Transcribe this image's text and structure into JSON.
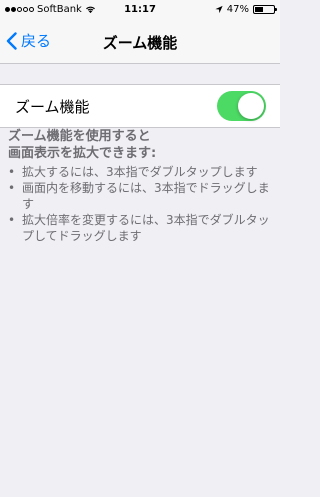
{
  "status_bar": {
    "carrier": "SoftBank",
    "time": "11:17",
    "battery_percent": "47%",
    "battery_level": 0.47,
    "signal_bars": [
      true,
      true,
      false,
      false,
      false
    ]
  },
  "nav": {
    "back_label": "戻る",
    "title": "ズーム機能"
  },
  "settings": {
    "zoom_label": "ズーム機能",
    "zoom_enabled": true,
    "toggle_color": "#4cd964"
  },
  "footer": {
    "heading": "ズーム機能を使用すると\n画面表示を拡大できます:",
    "bullet": "•",
    "items": [
      "拡大するには、3本指でダブルタップします",
      "画面内を移動するには、3本指でドラッグします",
      "拡大倍率を変更するには、3本指でダブルタップしてドラッグします"
    ]
  },
  "colors": {
    "accent": "#007aff",
    "background": "#efeff4",
    "footer_text": "#6d6d72"
  }
}
